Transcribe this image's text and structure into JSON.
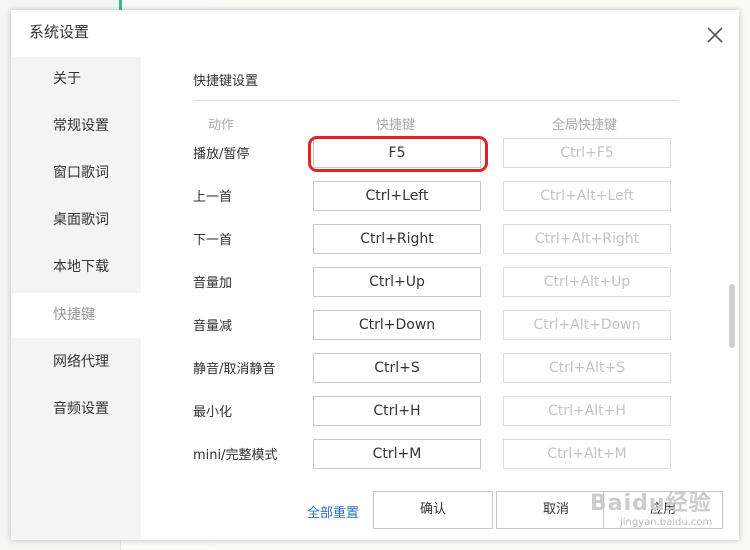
{
  "window": {
    "title": "系统设置"
  },
  "sidebar": {
    "items": [
      {
        "label": "关于"
      },
      {
        "label": "常规设置"
      },
      {
        "label": "窗口歌词"
      },
      {
        "label": "桌面歌词"
      },
      {
        "label": "本地下载"
      },
      {
        "label": "快捷键"
      },
      {
        "label": "网络代理"
      },
      {
        "label": "音频设置"
      }
    ],
    "active": "快捷键"
  },
  "content": {
    "title": "快捷键设置",
    "columns": {
      "action": "动作",
      "hotkey": "快捷键",
      "global": "全局快捷键"
    },
    "rows": [
      {
        "action": "播放/暂停",
        "hotkey": "F5",
        "global": "Ctrl+F5"
      },
      {
        "action": "上一首",
        "hotkey": "Ctrl+Left",
        "global": "Ctrl+Alt+Left"
      },
      {
        "action": "下一首",
        "hotkey": "Ctrl+Right",
        "global": "Ctrl+Alt+Right"
      },
      {
        "action": "音量加",
        "hotkey": "Ctrl+Up",
        "global": "Ctrl+Alt+Up"
      },
      {
        "action": "音量减",
        "hotkey": "Ctrl+Down",
        "global": "Ctrl+Alt+Down"
      },
      {
        "action": "静音/取消静音",
        "hotkey": "Ctrl+S",
        "global": "Ctrl+Alt+S"
      },
      {
        "action": "最小化",
        "hotkey": "Ctrl+H",
        "global": "Ctrl+Alt+H"
      },
      {
        "action": "mini/完整模式",
        "hotkey": "Ctrl+M",
        "global": "Ctrl+Alt+M"
      }
    ]
  },
  "footer": {
    "reset": "全部重置",
    "ok": "确认",
    "cancel": "取消",
    "apply": "应用"
  },
  "watermark": {
    "text": "Baidu经验",
    "sub": "jingyan.baidu.com"
  },
  "colors": {
    "accent": "#31c27c",
    "link": "#2a6fc9",
    "highlight": "#e02424"
  },
  "icons": {
    "close": "close-icon"
  }
}
